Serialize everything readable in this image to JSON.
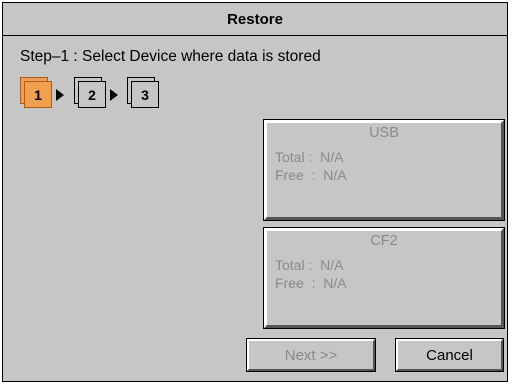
{
  "window": {
    "title": "Restore"
  },
  "step_text": "Step–1  :  Select Device where data is stored",
  "steps": [
    {
      "label": "1",
      "active": true
    },
    {
      "label": "2",
      "active": false
    },
    {
      "label": "3",
      "active": false
    }
  ],
  "devices": [
    {
      "name": "USB",
      "total_label": "Total",
      "total_value": "N/A",
      "free_label": "Free",
      "free_value": "N/A"
    },
    {
      "name": "CF2",
      "total_label": "Total",
      "total_value": "N/A",
      "free_label": "Free",
      "free_value": "N/A"
    }
  ],
  "buttons": {
    "next_label": "Next  >>",
    "cancel_label": "Cancel"
  }
}
